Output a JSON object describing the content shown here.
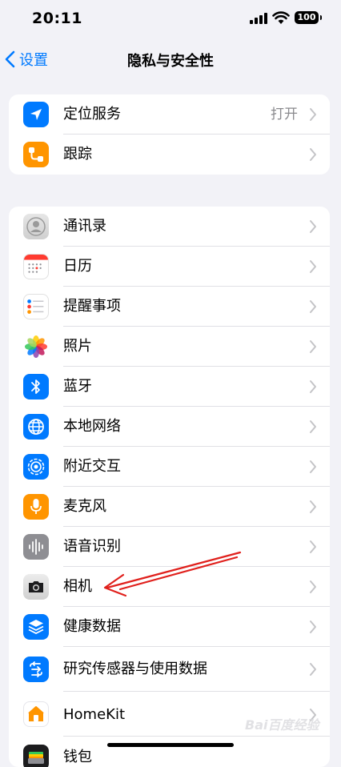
{
  "status_bar": {
    "time": "20:11",
    "battery": "100"
  },
  "nav": {
    "back_label": "设置",
    "title": "隐私与安全性"
  },
  "group1": [
    {
      "label": "定位服务",
      "value": "打开",
      "icon": "location-arrow-icon",
      "color": "#007aff"
    },
    {
      "label": "跟踪",
      "icon": "tracking-icon",
      "color": "#ff9500"
    }
  ],
  "group2": [
    {
      "label": "通讯录",
      "icon": "contacts-icon"
    },
    {
      "label": "日历",
      "icon": "calendar-icon"
    },
    {
      "label": "提醒事项",
      "icon": "reminders-icon"
    },
    {
      "label": "照片",
      "icon": "photos-icon"
    },
    {
      "label": "蓝牙",
      "icon": "bluetooth-icon",
      "color": "#007aff"
    },
    {
      "label": "本地网络",
      "icon": "globe-icon",
      "color": "#007aff"
    },
    {
      "label": "附近交互",
      "icon": "nearby-interactions-icon",
      "color": "#007aff"
    },
    {
      "label": "麦克风",
      "icon": "microphone-icon",
      "color": "#ff9500"
    },
    {
      "label": "语音识别",
      "icon": "speech-waveform-icon",
      "color": "#8e8e93"
    },
    {
      "label": "相机",
      "icon": "camera-icon",
      "color": "#e5e5ea"
    },
    {
      "label": "健康数据",
      "icon": "health-data-icon",
      "color": "#007aff"
    },
    {
      "label": "研究传感器与使用数据",
      "icon": "research-sensor-icon",
      "color": "#007aff"
    },
    {
      "label": "HomeKit",
      "icon": "home-icon",
      "color": "#ffffff"
    },
    {
      "label": "钱包",
      "icon": "wallet-icon",
      "color": "#1c1c1e"
    }
  ],
  "watermark": "Bai百度经验"
}
